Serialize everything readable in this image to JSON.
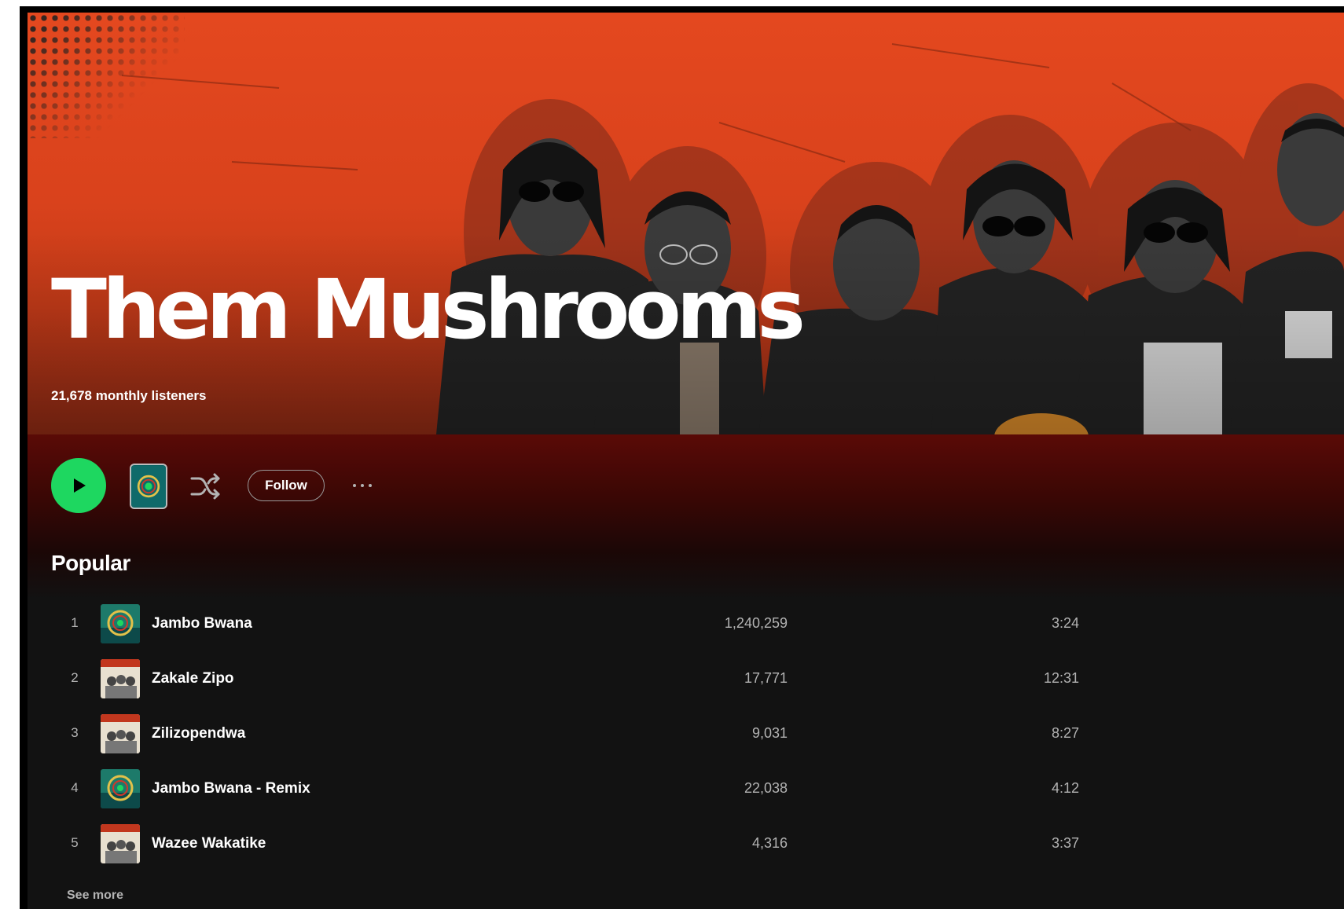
{
  "artist": {
    "name": "Them Mushrooms",
    "monthly_listeners": "21,678 monthly listeners"
  },
  "actions": {
    "follow_label": "Follow"
  },
  "popular": {
    "title": "Popular",
    "see_more_label": "See more",
    "tracks": [
      {
        "rank": "1",
        "title": "Jambo Bwana",
        "plays": "1,240,259",
        "duration": "3:24",
        "art": "jambo-bwana-cover"
      },
      {
        "rank": "2",
        "title": "Zakale Zipo",
        "plays": "17,771",
        "duration": "12:31",
        "art": "wazee-cover"
      },
      {
        "rank": "3",
        "title": "Zilizopendwa",
        "plays": "9,031",
        "duration": "8:27",
        "art": "wazee-cover"
      },
      {
        "rank": "4",
        "title": "Jambo Bwana - Remix",
        "plays": "22,038",
        "duration": "4:12",
        "art": "jambo-bwana-cover"
      },
      {
        "rank": "5",
        "title": "Wazee Wakatike",
        "plays": "4,316",
        "duration": "3:37",
        "art": "wazee-cover"
      }
    ]
  },
  "colors": {
    "hero_orange": "#e4481f",
    "play_green": "#1ed760",
    "background": "#121212",
    "dark_red_gradient": "#5a0a06"
  }
}
